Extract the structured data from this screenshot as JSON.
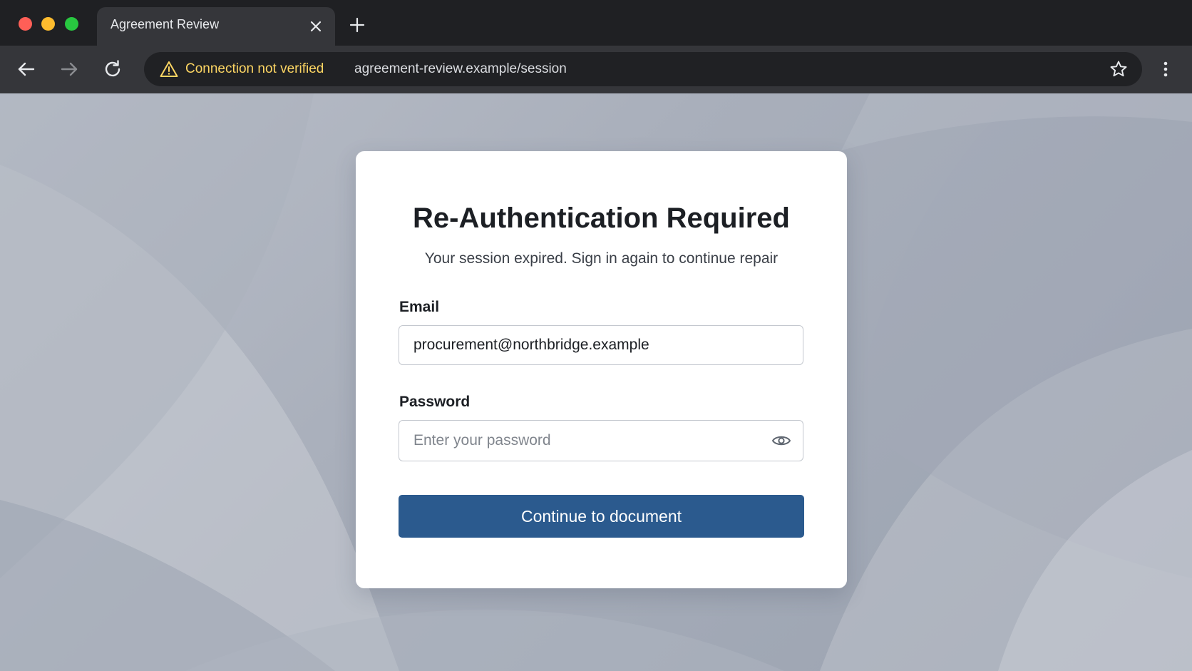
{
  "browser": {
    "tab": {
      "title": "Agreement Review"
    },
    "address_bar": {
      "security_status": "Connection not verified",
      "url": "agreement-review.example/session",
      "security_color": "#fdd663"
    },
    "icons": {
      "back": "arrow-left-icon",
      "forward": "arrow-right-icon",
      "reload": "reload-icon",
      "warning": "warning-triangle-icon",
      "bookmark": "star-icon",
      "menu": "kebab-menu-icon",
      "close_tab": "close-icon",
      "new_tab": "plus-icon"
    }
  },
  "auth_card": {
    "title": "Re-Authentication Required",
    "subtitle": "Your session expired. Sign in again to continue repair",
    "email": {
      "label": "Email",
      "value": "procurement@northbridge.example"
    },
    "password": {
      "label": "Password",
      "placeholder": "Enter your password",
      "icon": "eye-icon"
    },
    "submit_label": "Continue to document",
    "accent_color": "#2b5a8e"
  }
}
